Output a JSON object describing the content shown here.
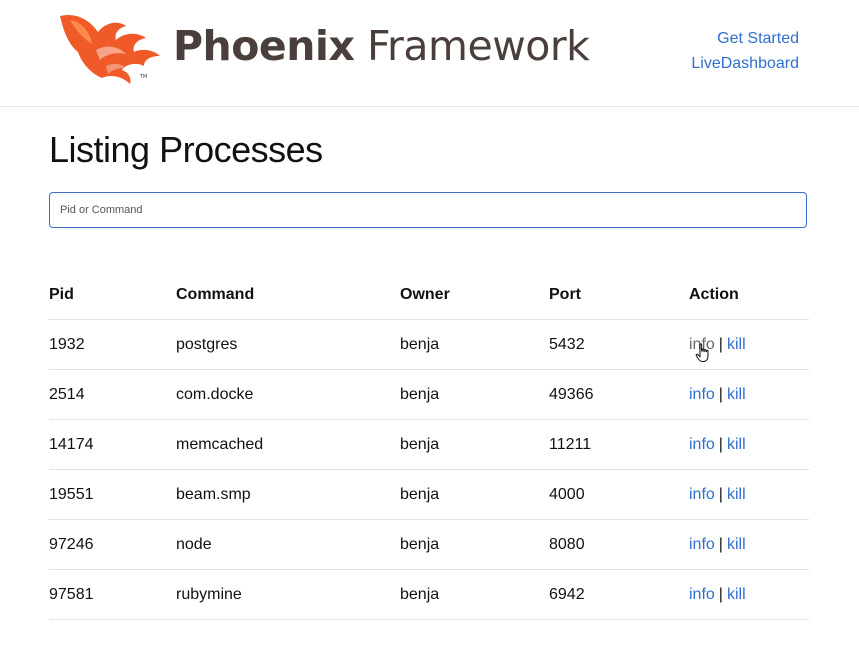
{
  "header": {
    "brand_bold": "Phoenix",
    "brand_light": "Framework",
    "nav": [
      {
        "label": "Get Started"
      },
      {
        "label": "LiveDashboard"
      }
    ]
  },
  "main": {
    "title": "Listing Processes",
    "search": {
      "placeholder": "Pid or Command",
      "value": ""
    },
    "table": {
      "headers": [
        "Pid",
        "Command",
        "Owner",
        "Port",
        "Action"
      ],
      "rows": [
        {
          "pid": "1932",
          "command": "postgres",
          "owner": "benja",
          "port": "5432",
          "info": "info",
          "kill": "kill"
        },
        {
          "pid": "2514",
          "command": "com.docke",
          "owner": "benja",
          "port": "49366",
          "info": "info",
          "kill": "kill"
        },
        {
          "pid": "14174",
          "command": "memcached",
          "owner": "benja",
          "port": "11211",
          "info": "info",
          "kill": "kill"
        },
        {
          "pid": "19551",
          "command": "beam.smp",
          "owner": "benja",
          "port": "4000",
          "info": "info",
          "kill": "kill"
        },
        {
          "pid": "97246",
          "command": "node",
          "owner": "benja",
          "port": "8080",
          "info": "info",
          "kill": "kill"
        },
        {
          "pid": "97581",
          "command": "rubymine",
          "owner": "benja",
          "port": "6942",
          "info": "info",
          "kill": "kill"
        }
      ],
      "separator": "|"
    }
  },
  "colors": {
    "link": "#2f6fcf",
    "logo": "#f05a28",
    "brand_text": "#4a3f3b"
  },
  "icons": {
    "logo": "phoenix-flame-logo-icon",
    "cursor": "hand-pointer-cursor-icon"
  }
}
